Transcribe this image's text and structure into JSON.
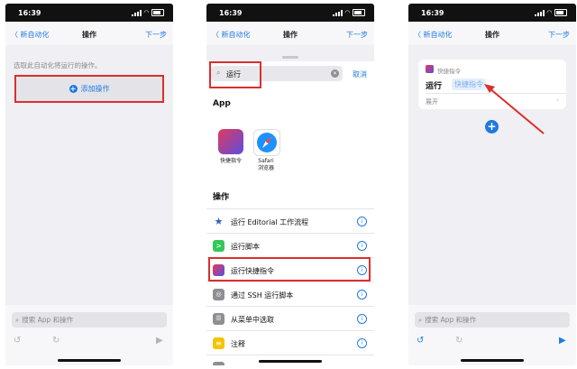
{
  "panel1": {
    "status_time": "16:39",
    "nav": {
      "back": "〈 新自动化",
      "title": "操作",
      "next": "下一步"
    },
    "hint": "选取此自动化将运行的操作。",
    "add_action": "添加操作",
    "search_placeholder": "搜索 App 和操作"
  },
  "panel2": {
    "status_time": "16:39",
    "nav": {
      "back": "〈 新自动化",
      "title": "操作",
      "next": "下一步"
    },
    "search_value": "运行",
    "cancel": "取消",
    "apps_header": "App",
    "apps": [
      {
        "name": "快捷指令",
        "icon": "shortcuts-icon"
      },
      {
        "name": "Safari\n浏览器",
        "icon": "safari-icon"
      }
    ],
    "actions_header": "操作",
    "actions": [
      {
        "label": "运行 Editorial 工作流程",
        "icon": "star-icon",
        "color": "#3a5bc7"
      },
      {
        "label": "运行脚本",
        "icon": "play-icon",
        "color": "#34c759"
      },
      {
        "label": "运行快捷指令",
        "icon": "shortcuts-icon",
        "color": "#e2395b"
      },
      {
        "label": "通过 SSH 运行脚本",
        "icon": "ssh-icon",
        "color": "#8e8e93"
      },
      {
        "label": "从菜单中选取",
        "icon": "menu-icon",
        "color": "#8e8e93"
      },
      {
        "label": "注释",
        "icon": "note-icon",
        "color": "#f5c400"
      }
    ]
  },
  "panel3": {
    "status_time": "16:39",
    "nav": {
      "back": "〈 新自动化",
      "title": "操作",
      "next": "下一步"
    },
    "card_caption": "快捷指令",
    "run_label": "运行",
    "token": "快捷指令",
    "expand": "展开",
    "search_placeholder": "搜索 App 和操作"
  },
  "colors": {
    "accent": "#1f7ae0",
    "highlight": "#d9302c"
  }
}
